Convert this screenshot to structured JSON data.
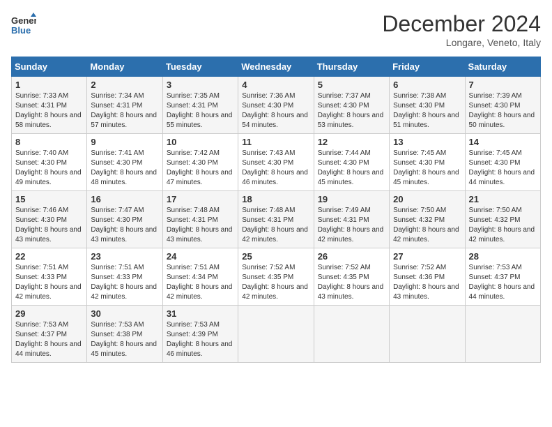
{
  "header": {
    "logo_line1": "General",
    "logo_line2": "Blue",
    "month": "December 2024",
    "location": "Longare, Veneto, Italy"
  },
  "weekdays": [
    "Sunday",
    "Monday",
    "Tuesday",
    "Wednesday",
    "Thursday",
    "Friday",
    "Saturday"
  ],
  "weeks": [
    [
      {
        "day": "1",
        "sunrise": "7:33 AM",
        "sunset": "4:31 PM",
        "daylight": "8 hours and 58 minutes."
      },
      {
        "day": "2",
        "sunrise": "7:34 AM",
        "sunset": "4:31 PM",
        "daylight": "8 hours and 57 minutes."
      },
      {
        "day": "3",
        "sunrise": "7:35 AM",
        "sunset": "4:31 PM",
        "daylight": "8 hours and 55 minutes."
      },
      {
        "day": "4",
        "sunrise": "7:36 AM",
        "sunset": "4:30 PM",
        "daylight": "8 hours and 54 minutes."
      },
      {
        "day": "5",
        "sunrise": "7:37 AM",
        "sunset": "4:30 PM",
        "daylight": "8 hours and 53 minutes."
      },
      {
        "day": "6",
        "sunrise": "7:38 AM",
        "sunset": "4:30 PM",
        "daylight": "8 hours and 51 minutes."
      },
      {
        "day": "7",
        "sunrise": "7:39 AM",
        "sunset": "4:30 PM",
        "daylight": "8 hours and 50 minutes."
      }
    ],
    [
      {
        "day": "8",
        "sunrise": "7:40 AM",
        "sunset": "4:30 PM",
        "daylight": "8 hours and 49 minutes."
      },
      {
        "day": "9",
        "sunrise": "7:41 AM",
        "sunset": "4:30 PM",
        "daylight": "8 hours and 48 minutes."
      },
      {
        "day": "10",
        "sunrise": "7:42 AM",
        "sunset": "4:30 PM",
        "daylight": "8 hours and 47 minutes."
      },
      {
        "day": "11",
        "sunrise": "7:43 AM",
        "sunset": "4:30 PM",
        "daylight": "8 hours and 46 minutes."
      },
      {
        "day": "12",
        "sunrise": "7:44 AM",
        "sunset": "4:30 PM",
        "daylight": "8 hours and 45 minutes."
      },
      {
        "day": "13",
        "sunrise": "7:45 AM",
        "sunset": "4:30 PM",
        "daylight": "8 hours and 45 minutes."
      },
      {
        "day": "14",
        "sunrise": "7:45 AM",
        "sunset": "4:30 PM",
        "daylight": "8 hours and 44 minutes."
      }
    ],
    [
      {
        "day": "15",
        "sunrise": "7:46 AM",
        "sunset": "4:30 PM",
        "daylight": "8 hours and 43 minutes."
      },
      {
        "day": "16",
        "sunrise": "7:47 AM",
        "sunset": "4:30 PM",
        "daylight": "8 hours and 43 minutes."
      },
      {
        "day": "17",
        "sunrise": "7:48 AM",
        "sunset": "4:31 PM",
        "daylight": "8 hours and 43 minutes."
      },
      {
        "day": "18",
        "sunrise": "7:48 AM",
        "sunset": "4:31 PM",
        "daylight": "8 hours and 42 minutes."
      },
      {
        "day": "19",
        "sunrise": "7:49 AM",
        "sunset": "4:31 PM",
        "daylight": "8 hours and 42 minutes."
      },
      {
        "day": "20",
        "sunrise": "7:50 AM",
        "sunset": "4:32 PM",
        "daylight": "8 hours and 42 minutes."
      },
      {
        "day": "21",
        "sunrise": "7:50 AM",
        "sunset": "4:32 PM",
        "daylight": "8 hours and 42 minutes."
      }
    ],
    [
      {
        "day": "22",
        "sunrise": "7:51 AM",
        "sunset": "4:33 PM",
        "daylight": "8 hours and 42 minutes."
      },
      {
        "day": "23",
        "sunrise": "7:51 AM",
        "sunset": "4:33 PM",
        "daylight": "8 hours and 42 minutes."
      },
      {
        "day": "24",
        "sunrise": "7:51 AM",
        "sunset": "4:34 PM",
        "daylight": "8 hours and 42 minutes."
      },
      {
        "day": "25",
        "sunrise": "7:52 AM",
        "sunset": "4:35 PM",
        "daylight": "8 hours and 42 minutes."
      },
      {
        "day": "26",
        "sunrise": "7:52 AM",
        "sunset": "4:35 PM",
        "daylight": "8 hours and 43 minutes."
      },
      {
        "day": "27",
        "sunrise": "7:52 AM",
        "sunset": "4:36 PM",
        "daylight": "8 hours and 43 minutes."
      },
      {
        "day": "28",
        "sunrise": "7:53 AM",
        "sunset": "4:37 PM",
        "daylight": "8 hours and 44 minutes."
      }
    ],
    [
      {
        "day": "29",
        "sunrise": "7:53 AM",
        "sunset": "4:37 PM",
        "daylight": "8 hours and 44 minutes."
      },
      {
        "day": "30",
        "sunrise": "7:53 AM",
        "sunset": "4:38 PM",
        "daylight": "8 hours and 45 minutes."
      },
      {
        "day": "31",
        "sunrise": "7:53 AM",
        "sunset": "4:39 PM",
        "daylight": "8 hours and 46 minutes."
      },
      null,
      null,
      null,
      null
    ]
  ],
  "labels": {
    "sunrise": "Sunrise:",
    "sunset": "Sunset:",
    "daylight": "Daylight:"
  }
}
